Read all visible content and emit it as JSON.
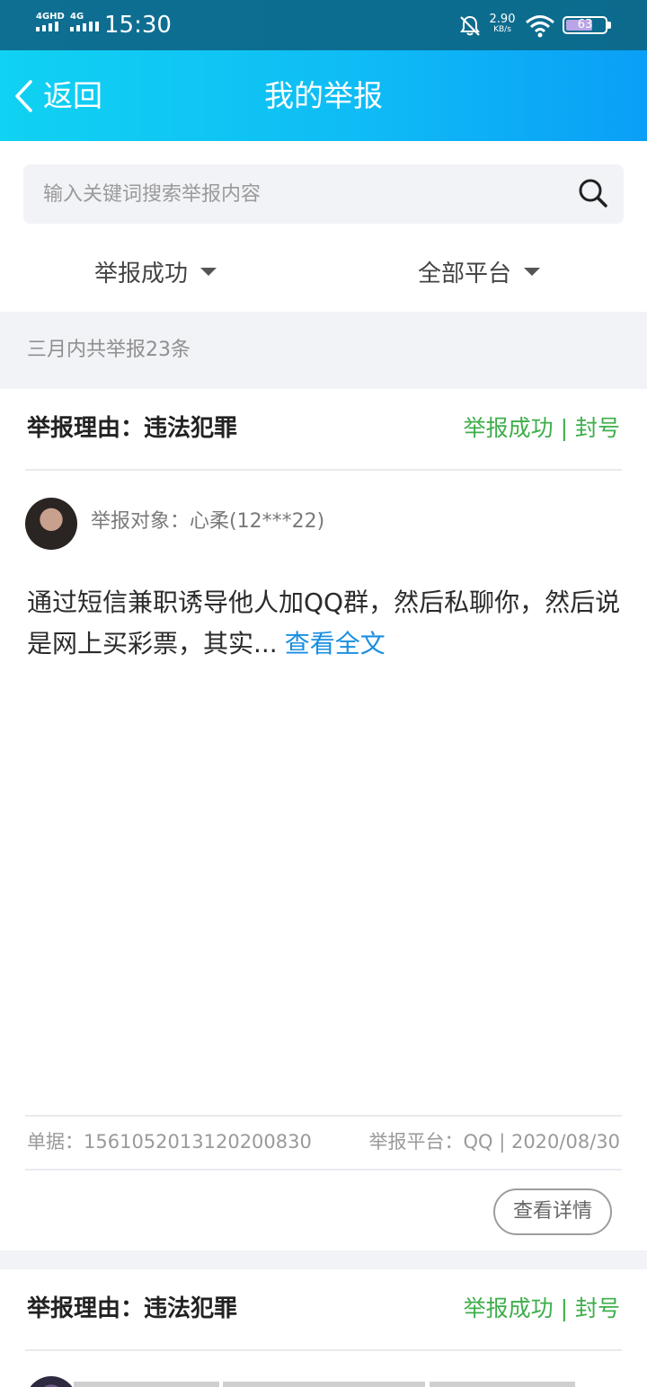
{
  "status_bar": {
    "signal_1": "4GHD",
    "signal_2": "4G",
    "time": "15:30",
    "net_speed": "2.90",
    "net_speed_unit": "KB/s",
    "battery": "63"
  },
  "nav": {
    "back_label": "返回",
    "title": "我的举报"
  },
  "search": {
    "placeholder": "输入关键词搜索举报内容"
  },
  "filters": {
    "status": "举报成功",
    "platform": "全部平台"
  },
  "summary": "三月内共举报23条",
  "reports": [
    {
      "reason": "举报理由：违法犯罪",
      "status": "举报成功 | 封号",
      "target": "举报对象：心柔(12***22)",
      "content": "通过短信兼职诱导他人加QQ群，然后私聊你，然后说是网上买彩票，其实...",
      "read_more": "查看全文",
      "order": "单据：1561052013120200830",
      "platform_date": "举报平台：QQ | 2020/08/30",
      "detail_button": "查看详情"
    },
    {
      "reason": "举报理由：违法犯罪",
      "status": "举报成功 | 封号"
    }
  ],
  "colors": {
    "nav_start": "#10d2f2",
    "nav_end": "#0a9ff7",
    "status_green": "#3fae4b",
    "link_blue": "#1a8fe0"
  }
}
